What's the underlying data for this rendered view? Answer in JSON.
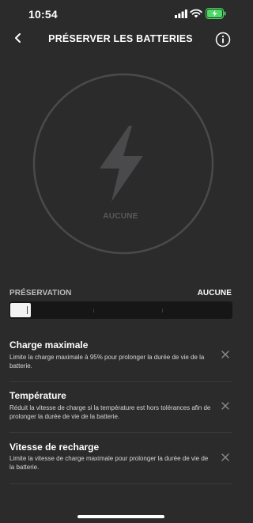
{
  "status_bar": {
    "time": "10:54"
  },
  "header": {
    "title": "PRÉSERVER LES BATTERIES"
  },
  "mode_display": {
    "label": "AUCUNE"
  },
  "preservation": {
    "label": "PRÉSERVATION",
    "value": "AUCUNE",
    "level": 0
  },
  "settings": [
    {
      "title": "Charge maximale",
      "description": "Limite la charge maximale à 95% pour prolonger la durée de vie de la batterie."
    },
    {
      "title": "Température",
      "description": "Réduit la vitesse de charge si la température est hors tolérances afin de prolonger la durée de vie de la batterie."
    },
    {
      "title": "Vitesse de recharge",
      "description": "Limite la vitesse de charge maximale pour prolonger la durée de vie de la batterie."
    }
  ],
  "icons": [
    "signal-icon",
    "wifi-icon",
    "battery-charging-icon",
    "back-chevron-icon",
    "info-icon",
    "lightning-bolt-icon",
    "close-icon"
  ],
  "colors": {
    "background": "#2b2b2c",
    "battery": "#4cd964",
    "muted": "#5a5a5c"
  }
}
